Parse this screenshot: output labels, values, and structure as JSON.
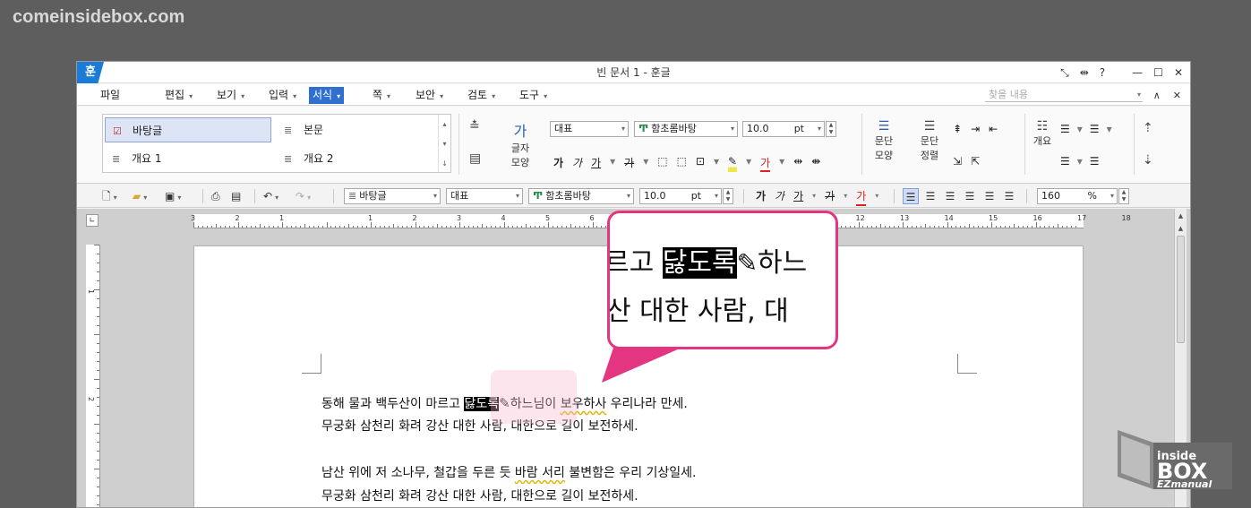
{
  "watermark": "comeinsidebox.com",
  "window": {
    "app_icon": "훈",
    "title": "빈 문서 1 - 훈글",
    "controls": [
      "⤡",
      "⇹",
      "?",
      "—",
      "☐",
      "✕"
    ]
  },
  "menu": {
    "items": [
      {
        "label": "파일",
        "arrow": ""
      },
      {
        "label": "편집",
        "arrow": "▾"
      },
      {
        "label": "보기",
        "arrow": "▾"
      },
      {
        "label": "입력",
        "arrow": "▾"
      },
      {
        "label": "서식",
        "arrow": "▾"
      },
      {
        "label": "쪽",
        "arrow": "▾"
      },
      {
        "label": "보안",
        "arrow": "▾"
      },
      {
        "label": "검토",
        "arrow": "▾"
      },
      {
        "label": "도구",
        "arrow": "▾"
      }
    ],
    "find_placeholder": "찾을 내용",
    "right_controls": [
      "▾",
      "∧",
      "✕"
    ]
  },
  "ribbon": {
    "styles": [
      {
        "label": "바탕글",
        "icon": "☑"
      },
      {
        "label": "본문",
        "icon": "≣"
      },
      {
        "label": "개요 1",
        "icon": "≣"
      },
      {
        "label": "개요 2",
        "icon": "≣"
      }
    ],
    "char_shape_label": "글자\n모양",
    "char_shape_label_1": "글자",
    "char_shape_label_2": "모양",
    "lang_combo": "대표",
    "font_combo": "함초롬바탕",
    "size_value": "10.0",
    "size_unit": "pt",
    "para_shape_label_1": "문단",
    "para_shape_label_2": "모양",
    "para_align_label_1": "문단",
    "para_align_label_2": "정렬",
    "outline_label": "개요",
    "format_glyphs": [
      "가",
      "가",
      "가",
      "가"
    ],
    "color_glyph": "가"
  },
  "toolbar": {
    "style_combo": "바탕글",
    "lang_combo": "대표",
    "font_combo": "함초롬바탕",
    "size_value": "10.0",
    "size_unit": "pt",
    "zoom_value": "160",
    "zoom_unit": "%"
  },
  "ruler": {
    "h_numbers": [
      "3",
      "2",
      "1",
      "",
      "1",
      "2",
      "3",
      "4",
      "5",
      "6",
      "7",
      "8",
      "9",
      "10",
      "11",
      "12",
      "13",
      "14",
      "15",
      "16",
      "17",
      "18"
    ],
    "v_numbers": [
      "1",
      "2"
    ]
  },
  "document": {
    "line1_pre": "동해 물과 백두산이 마르고 ",
    "line1_sel": "닳도록",
    "line1_post": "하느님이 ",
    "line1_wavy": "보우하사",
    "line1_end": " 우리나라 만세.",
    "line2": "무궁화 삼천리 화려 강산 대한 사람, 대한으로 길이 보전하세.",
    "line3_pre": "남산 위에 저 소나무, 철갑을 두른 듯 ",
    "line3_wavy": "바람 서리",
    "line3_end": " 불변함은 우리 기상일세.",
    "line4": "무궁화 삼천리 화려 강산 대한 사람, 대한으로 길이 보전하세."
  },
  "callout": {
    "line1_pre": "르고 ",
    "line1_sel": "닳도록",
    "line1_post": "하느",
    "line2": "산 대한 사람, 대"
  },
  "ez_logo": {
    "line1": "inside",
    "line2": "BOX",
    "line3": "EZmanual"
  },
  "colors": {
    "accent": "#2f6fd0",
    "callout_border": "#e43580",
    "selection": "#000000"
  }
}
